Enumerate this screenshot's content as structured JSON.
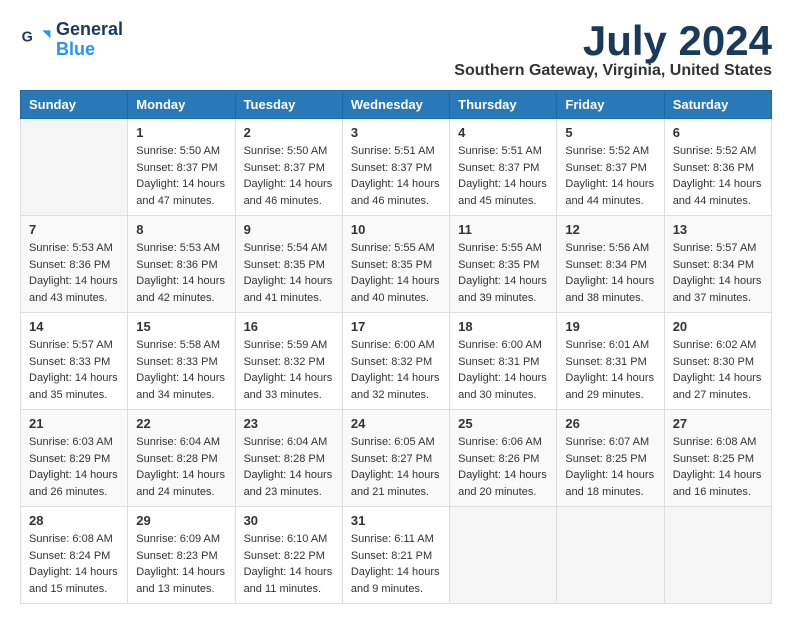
{
  "header": {
    "logo_line1": "General",
    "logo_line2": "Blue",
    "month_year": "July 2024",
    "location": "Southern Gateway, Virginia, United States"
  },
  "weekdays": [
    "Sunday",
    "Monday",
    "Tuesday",
    "Wednesday",
    "Thursday",
    "Friday",
    "Saturday"
  ],
  "weeks": [
    [
      {
        "day": "",
        "info": ""
      },
      {
        "day": "1",
        "info": "Sunrise: 5:50 AM\nSunset: 8:37 PM\nDaylight: 14 hours\nand 47 minutes."
      },
      {
        "day": "2",
        "info": "Sunrise: 5:50 AM\nSunset: 8:37 PM\nDaylight: 14 hours\nand 46 minutes."
      },
      {
        "day": "3",
        "info": "Sunrise: 5:51 AM\nSunset: 8:37 PM\nDaylight: 14 hours\nand 46 minutes."
      },
      {
        "day": "4",
        "info": "Sunrise: 5:51 AM\nSunset: 8:37 PM\nDaylight: 14 hours\nand 45 minutes."
      },
      {
        "day": "5",
        "info": "Sunrise: 5:52 AM\nSunset: 8:37 PM\nDaylight: 14 hours\nand 44 minutes."
      },
      {
        "day": "6",
        "info": "Sunrise: 5:52 AM\nSunset: 8:36 PM\nDaylight: 14 hours\nand 44 minutes."
      }
    ],
    [
      {
        "day": "7",
        "info": "Sunrise: 5:53 AM\nSunset: 8:36 PM\nDaylight: 14 hours\nand 43 minutes."
      },
      {
        "day": "8",
        "info": "Sunrise: 5:53 AM\nSunset: 8:36 PM\nDaylight: 14 hours\nand 42 minutes."
      },
      {
        "day": "9",
        "info": "Sunrise: 5:54 AM\nSunset: 8:35 PM\nDaylight: 14 hours\nand 41 minutes."
      },
      {
        "day": "10",
        "info": "Sunrise: 5:55 AM\nSunset: 8:35 PM\nDaylight: 14 hours\nand 40 minutes."
      },
      {
        "day": "11",
        "info": "Sunrise: 5:55 AM\nSunset: 8:35 PM\nDaylight: 14 hours\nand 39 minutes."
      },
      {
        "day": "12",
        "info": "Sunrise: 5:56 AM\nSunset: 8:34 PM\nDaylight: 14 hours\nand 38 minutes."
      },
      {
        "day": "13",
        "info": "Sunrise: 5:57 AM\nSunset: 8:34 PM\nDaylight: 14 hours\nand 37 minutes."
      }
    ],
    [
      {
        "day": "14",
        "info": "Sunrise: 5:57 AM\nSunset: 8:33 PM\nDaylight: 14 hours\nand 35 minutes."
      },
      {
        "day": "15",
        "info": "Sunrise: 5:58 AM\nSunset: 8:33 PM\nDaylight: 14 hours\nand 34 minutes."
      },
      {
        "day": "16",
        "info": "Sunrise: 5:59 AM\nSunset: 8:32 PM\nDaylight: 14 hours\nand 33 minutes."
      },
      {
        "day": "17",
        "info": "Sunrise: 6:00 AM\nSunset: 8:32 PM\nDaylight: 14 hours\nand 32 minutes."
      },
      {
        "day": "18",
        "info": "Sunrise: 6:00 AM\nSunset: 8:31 PM\nDaylight: 14 hours\nand 30 minutes."
      },
      {
        "day": "19",
        "info": "Sunrise: 6:01 AM\nSunset: 8:31 PM\nDaylight: 14 hours\nand 29 minutes."
      },
      {
        "day": "20",
        "info": "Sunrise: 6:02 AM\nSunset: 8:30 PM\nDaylight: 14 hours\nand 27 minutes."
      }
    ],
    [
      {
        "day": "21",
        "info": "Sunrise: 6:03 AM\nSunset: 8:29 PM\nDaylight: 14 hours\nand 26 minutes."
      },
      {
        "day": "22",
        "info": "Sunrise: 6:04 AM\nSunset: 8:28 PM\nDaylight: 14 hours\nand 24 minutes."
      },
      {
        "day": "23",
        "info": "Sunrise: 6:04 AM\nSunset: 8:28 PM\nDaylight: 14 hours\nand 23 minutes."
      },
      {
        "day": "24",
        "info": "Sunrise: 6:05 AM\nSunset: 8:27 PM\nDaylight: 14 hours\nand 21 minutes."
      },
      {
        "day": "25",
        "info": "Sunrise: 6:06 AM\nSunset: 8:26 PM\nDaylight: 14 hours\nand 20 minutes."
      },
      {
        "day": "26",
        "info": "Sunrise: 6:07 AM\nSunset: 8:25 PM\nDaylight: 14 hours\nand 18 minutes."
      },
      {
        "day": "27",
        "info": "Sunrise: 6:08 AM\nSunset: 8:25 PM\nDaylight: 14 hours\nand 16 minutes."
      }
    ],
    [
      {
        "day": "28",
        "info": "Sunrise: 6:08 AM\nSunset: 8:24 PM\nDaylight: 14 hours\nand 15 minutes."
      },
      {
        "day": "29",
        "info": "Sunrise: 6:09 AM\nSunset: 8:23 PM\nDaylight: 14 hours\nand 13 minutes."
      },
      {
        "day": "30",
        "info": "Sunrise: 6:10 AM\nSunset: 8:22 PM\nDaylight: 14 hours\nand 11 minutes."
      },
      {
        "day": "31",
        "info": "Sunrise: 6:11 AM\nSunset: 8:21 PM\nDaylight: 14 hours\nand 9 minutes."
      },
      {
        "day": "",
        "info": ""
      },
      {
        "day": "",
        "info": ""
      },
      {
        "day": "",
        "info": ""
      }
    ]
  ]
}
